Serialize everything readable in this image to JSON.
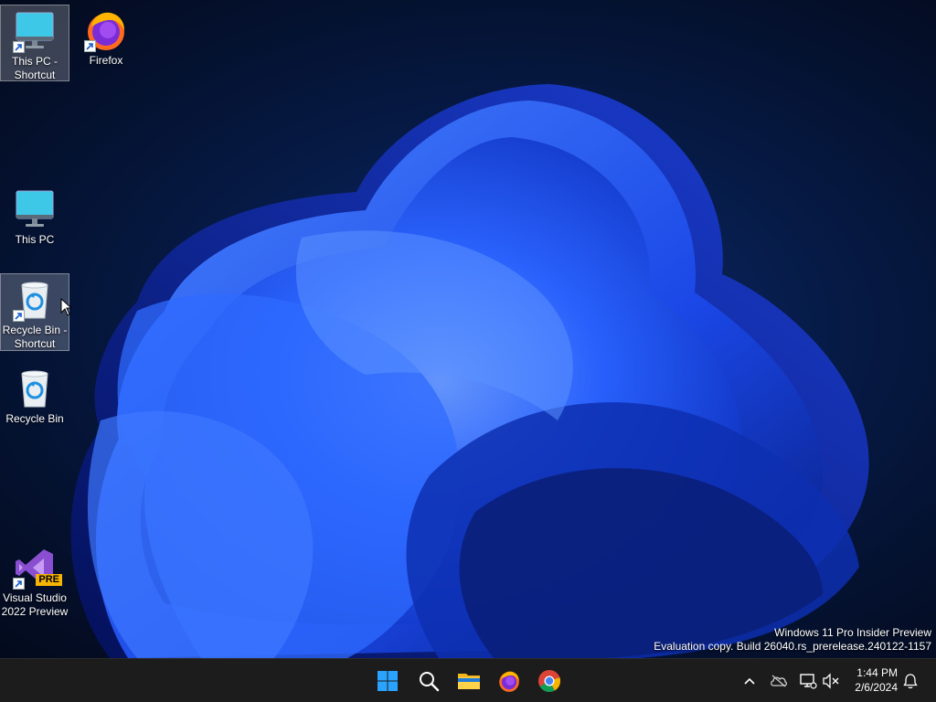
{
  "desktop": {
    "icons": [
      {
        "label": "This PC - Shortcut",
        "icon": "monitor-icon",
        "shortcut": true,
        "selected": true
      },
      {
        "label": "Firefox",
        "icon": "firefox-icon",
        "shortcut": true,
        "selected": false
      },
      {
        "label": "This PC",
        "icon": "monitor-icon",
        "shortcut": false,
        "selected": false
      },
      {
        "label": "Recycle Bin - Shortcut",
        "icon": "recycle-bin-icon",
        "shortcut": true,
        "selected": true
      },
      {
        "label": "Recycle Bin",
        "icon": "recycle-bin-icon",
        "shortcut": false,
        "selected": false
      },
      {
        "label": "Visual Studio 2022 Preview",
        "icon": "visual-studio-icon",
        "shortcut": true,
        "selected": false,
        "badge": "PRE"
      }
    ],
    "watermark": {
      "line1": "Windows 11 Pro Insider Preview",
      "line2": "Evaluation copy. Build 26040.rs_prerelease.240122-1157"
    }
  },
  "taskbar": {
    "apps": [
      {
        "name": "Start",
        "icon": "windows-logo-icon"
      },
      {
        "name": "Search",
        "icon": "search-icon"
      },
      {
        "name": "File Explorer",
        "icon": "folder-icon"
      },
      {
        "name": "Firefox",
        "icon": "firefox-icon"
      },
      {
        "name": "Chrome",
        "icon": "chrome-icon"
      }
    ],
    "tray": {
      "icons": [
        "chevron-up-icon",
        "onedrive-offline-icon",
        "network-icon",
        "volume-muted-icon"
      ],
      "time": "1:44 PM",
      "date": "2/6/2024",
      "notification_icon": "bell-icon"
    }
  },
  "colors": {
    "wallpaper_dark": "#040f2a",
    "bloom_blue": "#1e5bff",
    "taskbar_bg": "#1c1c1c",
    "start_blue": "#2aa3ff"
  }
}
